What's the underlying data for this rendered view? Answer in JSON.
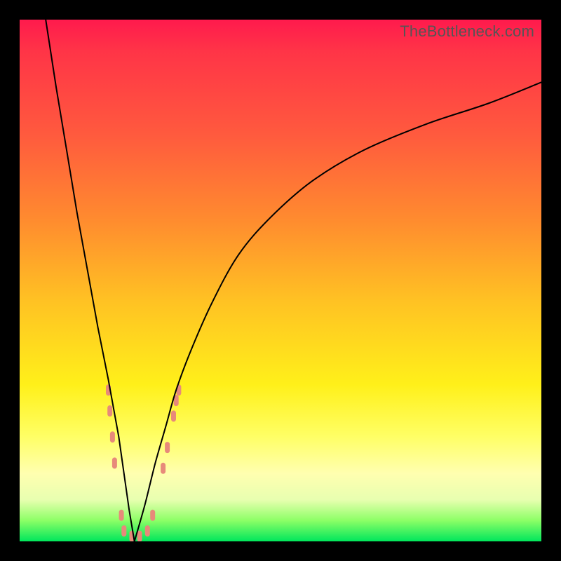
{
  "watermark": "TheBottleneck.com",
  "colors": {
    "frame": "#000000",
    "marker": "#e78a7a",
    "curve": "#000000",
    "gradient_stops": [
      "#ff1a4d",
      "#ff3447",
      "#ff5a3e",
      "#ff8a2f",
      "#ffc223",
      "#fff01a",
      "#ffff66",
      "#ffffb0",
      "#e8ffb0",
      "#8cff66",
      "#00e65c"
    ]
  },
  "chart_data": {
    "type": "line",
    "title": "",
    "xlabel": "",
    "ylabel": "",
    "xlim": [
      0,
      100
    ],
    "ylim": [
      0,
      100
    ],
    "note": "Axes unlabeled. x ≈ normalized horizontal position (0=left,100=right). y ≈ bottleneck percentage (0=green bottom, 100=red top). Curve is a V shape with minimum ~0 at x≈22; left arm rises to ~100 at x=5, right arm rises asymptotically to ~88 at x=100.",
    "series": [
      {
        "name": "curve-left-arm",
        "x": [
          5,
          7,
          9,
          11,
          13,
          15,
          17,
          19,
          20,
          21,
          22
        ],
        "y": [
          100,
          87,
          75,
          63,
          52,
          41,
          31,
          20,
          13,
          6,
          0
        ]
      },
      {
        "name": "curve-right-arm",
        "x": [
          22,
          24,
          26,
          28,
          30,
          33,
          37,
          42,
          48,
          56,
          66,
          78,
          90,
          100
        ],
        "y": [
          0,
          7,
          15,
          22,
          29,
          37,
          46,
          55,
          62,
          69,
          75,
          80,
          84,
          88
        ]
      }
    ],
    "markers": {
      "name": "highlighted-points",
      "description": "salmon lozenge-shaped markers clustered near the curve minimum",
      "points": [
        {
          "x": 17.0,
          "y": 29
        },
        {
          "x": 17.3,
          "y": 25
        },
        {
          "x": 17.8,
          "y": 20
        },
        {
          "x": 18.2,
          "y": 15
        },
        {
          "x": 19.5,
          "y": 5
        },
        {
          "x": 20.0,
          "y": 2
        },
        {
          "x": 21.5,
          "y": 1
        },
        {
          "x": 23.0,
          "y": 1
        },
        {
          "x": 24.5,
          "y": 2
        },
        {
          "x": 25.5,
          "y": 5
        },
        {
          "x": 27.5,
          "y": 14
        },
        {
          "x": 28.3,
          "y": 18
        },
        {
          "x": 29.5,
          "y": 24
        },
        {
          "x": 30.0,
          "y": 27
        },
        {
          "x": 30.5,
          "y": 29
        }
      ]
    }
  }
}
